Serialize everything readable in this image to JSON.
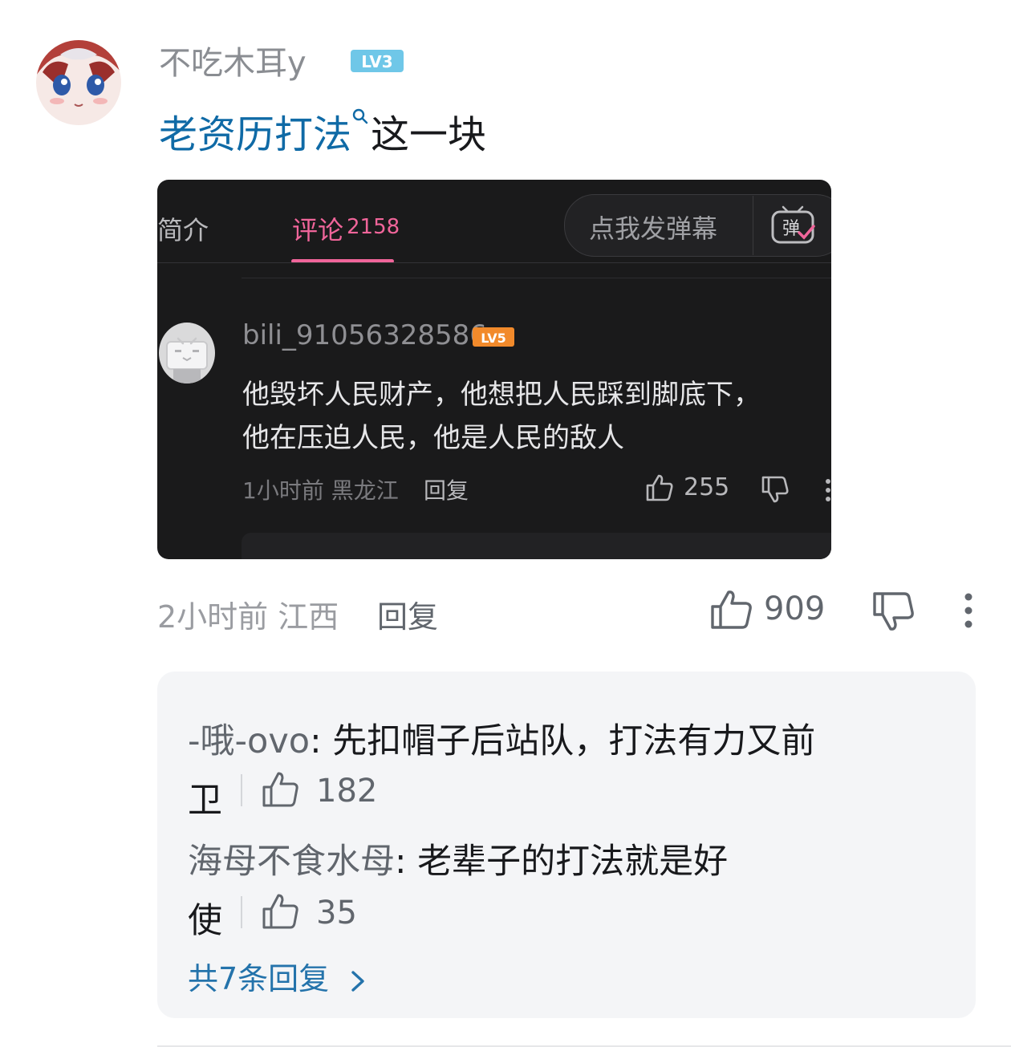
{
  "comment": {
    "username": "不吃木耳y",
    "level": "LV3",
    "keyword": "老资历打法",
    "text_suffix": "这一块",
    "time_location": "2小时前 江西",
    "reply_label": "回复",
    "likes": "909"
  },
  "embedded_screenshot": {
    "tab_intro": "简介",
    "tab_comments": "评论",
    "comment_count": "2158",
    "danmaku_placeholder": "点我发弹幕",
    "danmaku_icon_char": "弹",
    "user": "bili_91056328586",
    "level": "LV5",
    "line1": "他毁坏人民财产，他想把人民踩到脚底下，",
    "line2": "他在压迫人民，他是人民的敌人",
    "meta": "1小时前 黑龙江",
    "reply_label": "回复",
    "likes": "255"
  },
  "replies": [
    {
      "name": "-哦-ovo",
      "text_line1": ": 先扣帽子后站队，打法有力又前",
      "text_line2": "卫",
      "likes": "182"
    },
    {
      "name": "海母不食水母",
      "text_line1": ": 老辈子的打法就是好",
      "text_line2": "使",
      "likes": "35"
    }
  ],
  "more_replies": "共7条回复",
  "colors": {
    "link_blue": "#0f6aa6",
    "pink": "#f0659a",
    "level_blue": "#6fc7e8",
    "level_orange": "#f28a2b"
  }
}
